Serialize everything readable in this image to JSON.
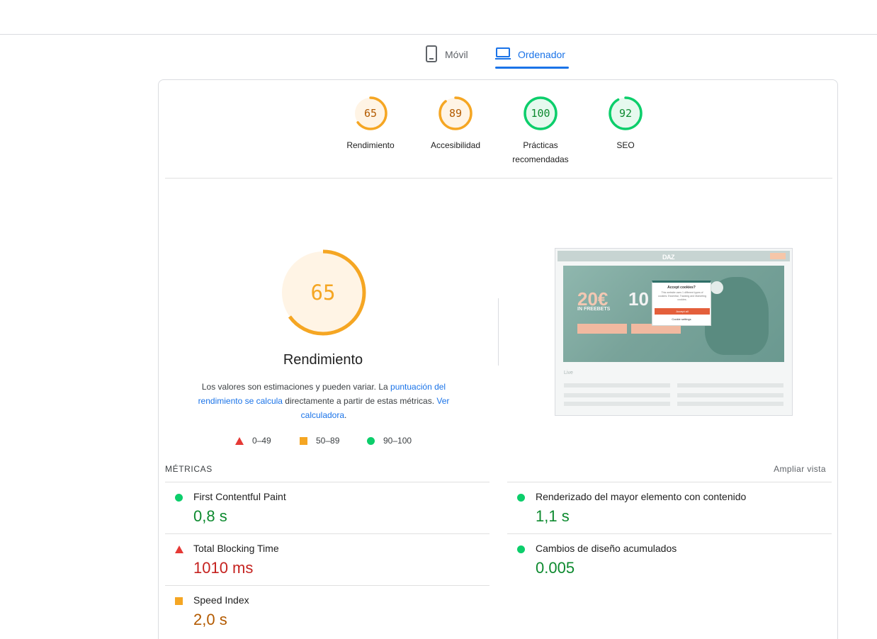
{
  "tabs": {
    "mobile_label": "Móvil",
    "desktop_label": "Ordenador",
    "active": "desktop"
  },
  "colors": {
    "good": "#0cce6b",
    "average": "#ffa400",
    "poor": "#ff4e42",
    "link": "#1a73e8"
  },
  "scores": [
    {
      "value": "65",
      "label": "Rendimiento",
      "label2": "",
      "rating": "average"
    },
    {
      "value": "89",
      "label": "Accesibilidad",
      "label2": "",
      "rating": "average"
    },
    {
      "value": "100",
      "label": "Prácticas",
      "label2": "recomendadas",
      "rating": "good"
    },
    {
      "value": "92",
      "label": "SEO",
      "label2": "",
      "rating": "good"
    }
  ],
  "performance": {
    "score": "65",
    "title": "Rendimiento",
    "desc_1": "Los valores son estimaciones y pueden variar. La ",
    "link_1": "puntuación del rendimiento se calcula",
    "desc_2": " directamente a partir de estas métricas. ",
    "link_2": "Ver calculadora",
    "desc_3": "."
  },
  "legend": {
    "poor": "0–49",
    "average": "50–89",
    "good": "90–100"
  },
  "screenshot": {
    "logo": "DAZ",
    "hero_amount": "20€",
    "hero_sub": "IN FREEBETS",
    "hero_amount_2": "10",
    "popup_title": "Accept cookies?",
    "popup_text": "This website uses 1 different types of cookies: Essential, Tracking and Marketing cookies.",
    "popup_button": "Accept all",
    "popup_link": "Cookie settings",
    "live_label": "Live"
  },
  "metrics": {
    "section_label": "MÉTRICAS",
    "expand_label": "Ampliar vista",
    "items": [
      {
        "name": "First Contentful Paint",
        "value": "0,8 s",
        "rating": "good"
      },
      {
        "name": "Renderizado del mayor elemento con contenido",
        "value": "1,1 s",
        "rating": "good"
      },
      {
        "name": "Total Blocking Time",
        "value": "1010 ms",
        "rating": "poor"
      },
      {
        "name": "Cambios de diseño acumulados",
        "value": "0.005",
        "rating": "good"
      },
      {
        "name": "Speed Index",
        "value": "2,0 s",
        "rating": "average"
      }
    ]
  }
}
